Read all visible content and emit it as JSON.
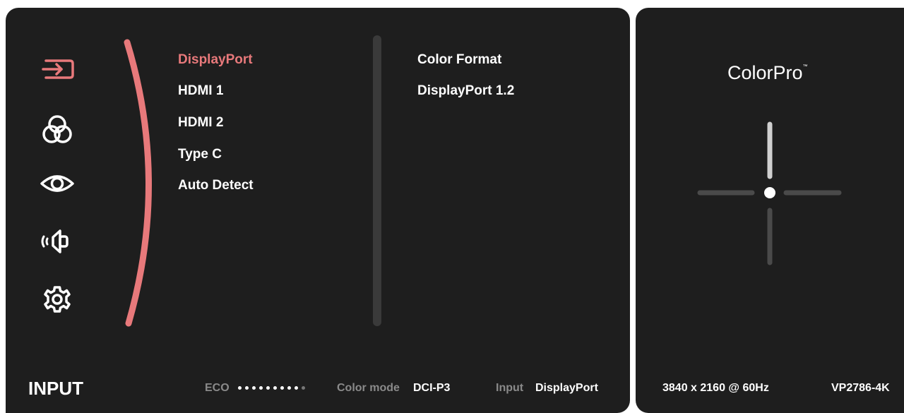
{
  "colors": {
    "panel_bg": "#1e1e1e",
    "accent": "#e8797b",
    "text": "#ffffff",
    "muted": "#8a8a8a",
    "divider": "#3a3a3a"
  },
  "sidebar": {
    "icons": [
      {
        "name": "input-icon",
        "active": true
      },
      {
        "name": "color-adjust-icon",
        "active": false
      },
      {
        "name": "view-mode-icon",
        "active": false
      },
      {
        "name": "audio-icon",
        "active": false
      },
      {
        "name": "setup-menu-icon",
        "active": false
      }
    ]
  },
  "menu": {
    "items": [
      {
        "label": "DisplayPort",
        "active": true
      },
      {
        "label": "HDMI 1",
        "active": false
      },
      {
        "label": "HDMI 2",
        "active": false
      },
      {
        "label": "Type C",
        "active": false
      },
      {
        "label": "Auto Detect",
        "active": false
      }
    ]
  },
  "detail": {
    "title": "Color Format",
    "value": "DisplayPort 1.2"
  },
  "footer": {
    "section_title": "INPUT",
    "eco_label": "ECO",
    "eco_level": "9 of 10",
    "color_mode_label": "Color mode",
    "color_mode_value": "DCI-P3",
    "input_label": "Input",
    "input_value": "DisplayPort"
  },
  "side_panel": {
    "brand": "ColorPro",
    "trademark": "™",
    "resolution": "3840 x 2160 @ 60Hz",
    "model": "VP2786-4K"
  }
}
